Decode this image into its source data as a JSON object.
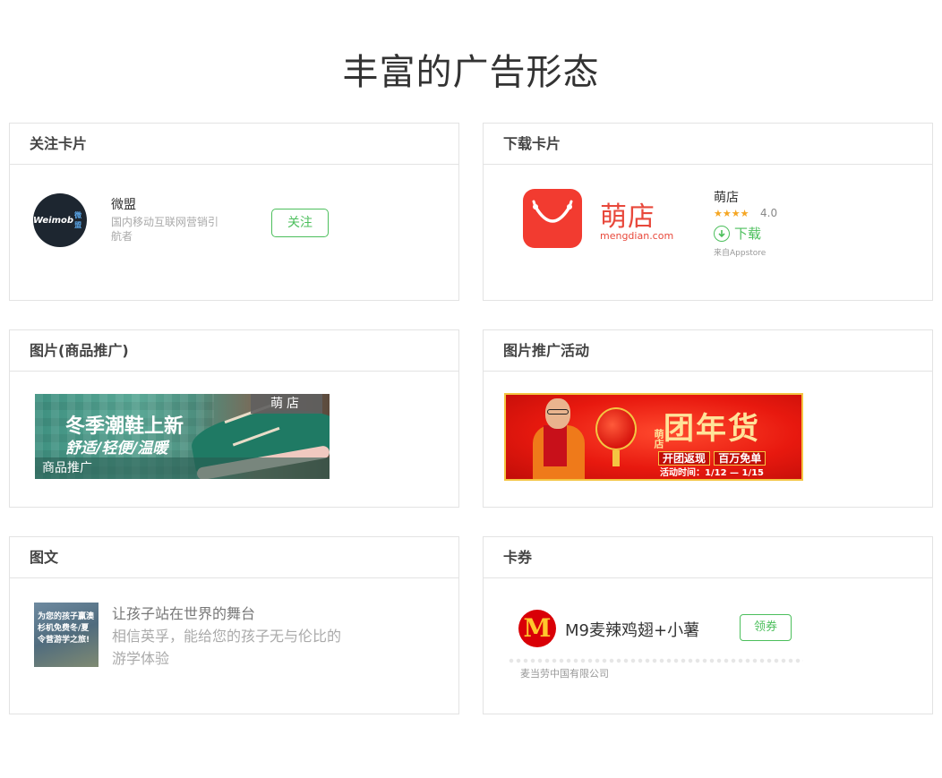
{
  "page": {
    "title": "丰富的广告形态"
  },
  "cards": {
    "follow": {
      "header": "关注卡片",
      "avatar_text": "Weimob",
      "avatar_sub": "微盟",
      "name": "微盟",
      "desc": "国内移动互联网营销引航者",
      "button": "关注"
    },
    "download": {
      "header": "下载卡片",
      "logo_text": "萌店",
      "logo_url": "mengdian.com",
      "app_name": "萌店",
      "stars": "★★★★",
      "rating": "4.0",
      "download_label": "下载",
      "source": "来自Appstore"
    },
    "product_image": {
      "header": "图片(商品推广)",
      "tag": "萌店",
      "line1": "冬季潮鞋上新",
      "line2": "舒适/轻便/温暖",
      "label": "商品推广"
    },
    "activity": {
      "header": "图片推广活动",
      "shop": "萌店",
      "title": "团年货",
      "sub1": "开团返现",
      "sub2": "百万免单",
      "time": "活动时间：1/12 — 1/15"
    },
    "image_text": {
      "header": "图文",
      "image_text": "为您的孩子赢澳杉机免费冬/夏令营游学之旅!",
      "title": "让孩子站在世界的舞台",
      "desc": "相信英孚，能给您的孩子无与伦比的游学体验"
    },
    "coupon": {
      "header": "卡券",
      "logo": "M",
      "name": "M9麦辣鸡翅+小薯",
      "button": "领券",
      "company": "麦当劳中国有限公司"
    }
  },
  "colors": {
    "accent_green": "#4cbf5c",
    "brand_red": "#e8483b",
    "border": "#e3e3e3"
  }
}
